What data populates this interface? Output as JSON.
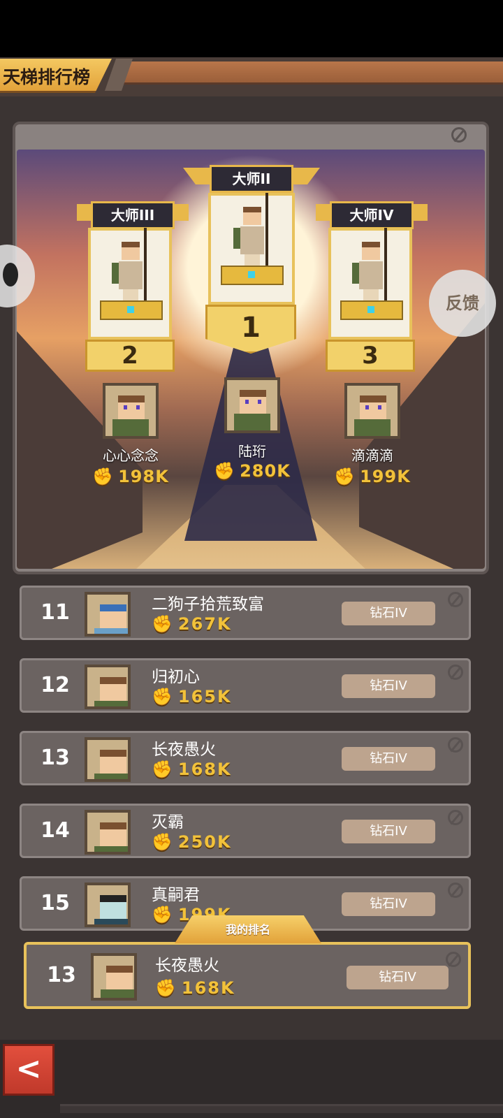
{
  "header": {
    "title": "天梯排行榜"
  },
  "podium": [
    {
      "place": "1",
      "division": "大师II",
      "name": "陆珩",
      "power": "280K"
    },
    {
      "place": "2",
      "division": "大师III",
      "name": "心心念念",
      "power": "198K"
    },
    {
      "place": "3",
      "division": "大师IV",
      "name": "滴滴滴",
      "power": "199K"
    }
  ],
  "rows": [
    {
      "rank": "11",
      "name": "二狗子拾荒致富",
      "power": "267K",
      "tier": "钻石IV"
    },
    {
      "rank": "12",
      "name": "归初心",
      "power": "165K",
      "tier": "钻石IV"
    },
    {
      "rank": "13",
      "name": "长夜愚火",
      "power": "168K",
      "tier": "钻石IV"
    },
    {
      "rank": "14",
      "name": "灭霸",
      "power": "250K",
      "tier": "钻石IV"
    },
    {
      "rank": "15",
      "name": "真嗣君",
      "power": "199K",
      "tier": "钻石IV"
    }
  ],
  "my_rank": {
    "label": "我的排名",
    "rank": "13",
    "name": "长夜愚火",
    "power": "168K",
    "tier": "钻石IV"
  },
  "floating": {
    "feedback": "反馈"
  },
  "nav": {
    "back": "<"
  },
  "icons": {
    "power": "fist-icon",
    "back": "chevron-left-icon",
    "info": "slash-circle-icon"
  },
  "colors": {
    "gold": "#f2c23a",
    "frame": "#e8c25b",
    "tier_badge": "#bda48e"
  }
}
